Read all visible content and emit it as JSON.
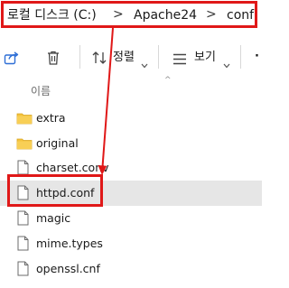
{
  "breadcrumb": {
    "items": [
      "로컬 디스크 (C:)",
      "Apache24",
      "conf"
    ],
    "separator": ">"
  },
  "toolbar": {
    "sort_label": "정렬",
    "view_label": "보기",
    "more_label": "·"
  },
  "list_header": {
    "name_label": "이름"
  },
  "files": [
    {
      "name": "extra",
      "type": "folder"
    },
    {
      "name": "original",
      "type": "folder"
    },
    {
      "name": "charset.conv",
      "type": "file"
    },
    {
      "name": "httpd.conf",
      "type": "file",
      "selected": true
    },
    {
      "name": "magic",
      "type": "file"
    },
    {
      "name": "mime.types",
      "type": "file"
    },
    {
      "name": "openssl.cnf",
      "type": "file"
    }
  ],
  "colors": {
    "annotation_red": "#e01818",
    "folder_yellow": "#f4c33d",
    "selection_gray": "#e6e6e6"
  }
}
